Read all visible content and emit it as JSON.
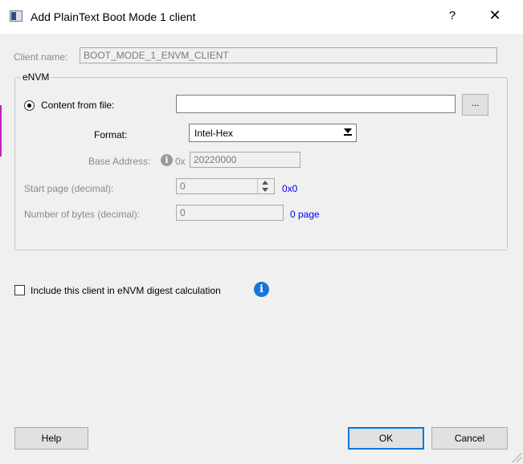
{
  "window": {
    "title": "Add PlainText Boot Mode 1 client",
    "help_label": "?",
    "close_label": "✕"
  },
  "client": {
    "label": "Client name:",
    "value": "BOOT_MODE_1_ENVM_CLIENT"
  },
  "envm": {
    "group_title": "eNVM",
    "content_from_file_label": "Content from file:",
    "file_value": "",
    "browse_label": "...",
    "format_label": "Format:",
    "format_value": "Intel-Hex",
    "base_address_label": "Base Address:",
    "base_address_prefix": "0x",
    "base_address_value": "20220000",
    "start_page_label": "Start page (decimal):",
    "start_page_value": "0",
    "start_page_hex": "0x0",
    "num_bytes_label": "Number of bytes (decimal):",
    "num_bytes_value": "0",
    "num_bytes_pages": "0 page"
  },
  "digest": {
    "label": "Include this client in eNVM digest calculation",
    "checked": false
  },
  "buttons": {
    "help": "Help",
    "ok": "OK",
    "cancel": "Cancel"
  },
  "colors": {
    "accent_blue": "#1a74d8",
    "link_blue": "#0000ee",
    "default_button_border": "#0078d7"
  }
}
